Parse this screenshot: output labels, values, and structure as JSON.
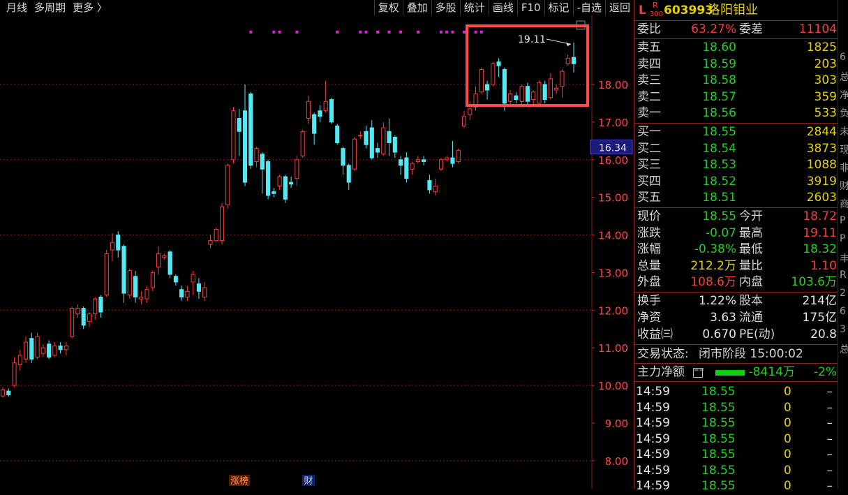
{
  "toolbar": {
    "left": [
      "月线",
      "多周期",
      "更多 〉"
    ],
    "right": [
      "复权",
      "叠加",
      "多股",
      "统计",
      "画线",
      "F10",
      "标记",
      "-自选",
      "返回"
    ]
  },
  "stock": {
    "market_letter": "L",
    "index_tag_top": "R",
    "index_tag_bottom": "300",
    "code": "603993",
    "name": "洛阳钼业"
  },
  "chart_data": {
    "type": "candlestick",
    "y_axis_labels": [
      "18.00",
      "17.00",
      "16.00",
      "15.00",
      "14.00",
      "13.00",
      "12.00",
      "11.00",
      "10.00",
      "9.00",
      "8.00"
    ],
    "ylim": [
      7.7,
      19.8
    ],
    "grid_lines": [
      18,
      16,
      14,
      12,
      10,
      8
    ],
    "current_price_tag": "16.34",
    "annotation_label": "19.11",
    "highlight_box": true,
    "bottom_tags": [
      "涨榜",
      "财"
    ],
    "candles": [
      {
        "o": 9.72,
        "c": 9.88,
        "h": 9.95,
        "l": 9.68
      },
      {
        "o": 9.85,
        "c": 9.75,
        "h": 9.92,
        "l": 9.7
      },
      {
        "o": 10.0,
        "c": 10.6,
        "h": 10.75,
        "l": 9.95
      },
      {
        "o": 10.55,
        "c": 10.8,
        "h": 10.95,
        "l": 10.4
      },
      {
        "o": 10.7,
        "c": 11.15,
        "h": 11.3,
        "l": 10.6
      },
      {
        "o": 11.25,
        "c": 10.7,
        "h": 11.4,
        "l": 10.6
      },
      {
        "o": 10.75,
        "c": 11.3,
        "h": 11.4,
        "l": 10.7
      },
      {
        "o": 10.85,
        "c": 11.0,
        "h": 11.1,
        "l": 10.75
      },
      {
        "o": 11.1,
        "c": 10.75,
        "h": 11.2,
        "l": 10.7
      },
      {
        "o": 10.8,
        "c": 11.05,
        "h": 11.15,
        "l": 10.75
      },
      {
        "o": 11.05,
        "c": 10.95,
        "h": 11.15,
        "l": 10.85
      },
      {
        "o": 10.95,
        "c": 11.05,
        "h": 11.15,
        "l": 10.8
      },
      {
        "o": 11.3,
        "c": 12.05,
        "h": 12.1,
        "l": 11.25
      },
      {
        "o": 11.9,
        "c": 12.05,
        "h": 12.15,
        "l": 11.8
      },
      {
        "o": 12.05,
        "c": 11.6,
        "h": 12.1,
        "l": 11.5
      },
      {
        "o": 11.7,
        "c": 11.9,
        "h": 11.95,
        "l": 11.55
      },
      {
        "o": 11.9,
        "c": 12.3,
        "h": 12.35,
        "l": 11.75
      },
      {
        "o": 12.35,
        "c": 11.95,
        "h": 12.4,
        "l": 11.8
      },
      {
        "o": 12.4,
        "c": 13.5,
        "h": 13.6,
        "l": 12.35
      },
      {
        "o": 13.6,
        "c": 13.8,
        "h": 14.05,
        "l": 13.3
      },
      {
        "o": 14.0,
        "c": 13.6,
        "h": 14.1,
        "l": 13.4
      },
      {
        "o": 13.7,
        "c": 12.45,
        "h": 13.75,
        "l": 12.2
      },
      {
        "o": 12.4,
        "c": 13.05,
        "h": 13.1,
        "l": 12.3
      },
      {
        "o": 12.9,
        "c": 12.35,
        "h": 13.05,
        "l": 12.2
      },
      {
        "o": 12.3,
        "c": 12.35,
        "h": 12.5,
        "l": 12.15
      },
      {
        "o": 12.3,
        "c": 12.55,
        "h": 12.65,
        "l": 12.2
      },
      {
        "o": 12.6,
        "c": 13.0,
        "h": 13.05,
        "l": 12.5
      },
      {
        "o": 13.15,
        "c": 13.5,
        "h": 13.7,
        "l": 12.95
      },
      {
        "o": 13.4,
        "c": 13.45,
        "h": 13.5,
        "l": 13.35
      },
      {
        "o": 13.55,
        "c": 12.95,
        "h": 13.6,
        "l": 12.85
      },
      {
        "o": 12.9,
        "c": 12.75,
        "h": 12.95,
        "l": 12.65
      },
      {
        "o": 12.55,
        "c": 12.35,
        "h": 12.65,
        "l": 12.25
      },
      {
        "o": 12.35,
        "c": 12.5,
        "h": 12.65,
        "l": 12.25
      },
      {
        "o": 12.75,
        "c": 12.95,
        "h": 13.05,
        "l": 12.4
      },
      {
        "o": 12.7,
        "c": 12.5,
        "h": 12.85,
        "l": 12.3
      },
      {
        "o": 12.35,
        "c": 12.6,
        "h": 12.75,
        "l": 12.25
      },
      {
        "o": 13.75,
        "c": 13.85,
        "h": 14.0,
        "l": 13.65
      },
      {
        "o": 13.85,
        "c": 14.15,
        "h": 14.2,
        "l": 13.8
      },
      {
        "o": 13.85,
        "c": 14.75,
        "h": 14.85,
        "l": 13.75
      },
      {
        "o": 14.8,
        "c": 15.85,
        "h": 15.9,
        "l": 14.7
      },
      {
        "o": 16.0,
        "c": 17.3,
        "h": 17.4,
        "l": 15.9
      },
      {
        "o": 17.1,
        "c": 16.75,
        "h": 17.35,
        "l": 16.1
      },
      {
        "o": 17.3,
        "c": 15.4,
        "h": 18.0,
        "l": 15.3
      },
      {
        "o": 17.75,
        "c": 15.85,
        "h": 17.8,
        "l": 15.75
      },
      {
        "o": 15.95,
        "c": 16.3,
        "h": 16.35,
        "l": 15.8
      },
      {
        "o": 16.15,
        "c": 15.75,
        "h": 16.2,
        "l": 15.1
      },
      {
        "o": 15.95,
        "c": 15.05,
        "h": 16.0,
        "l": 14.95
      },
      {
        "o": 15.15,
        "c": 15.1,
        "h": 15.25,
        "l": 15.0
      },
      {
        "o": 15.3,
        "c": 15.55,
        "h": 15.6,
        "l": 15.2
      },
      {
        "o": 15.55,
        "c": 14.95,
        "h": 15.6,
        "l": 14.85
      },
      {
        "o": 15.4,
        "c": 15.35,
        "h": 15.55,
        "l": 15.25
      },
      {
        "o": 15.5,
        "c": 16.0,
        "h": 16.1,
        "l": 15.3
      },
      {
        "o": 16.1,
        "c": 16.75,
        "h": 16.8,
        "l": 16.05
      },
      {
        "o": 17.1,
        "c": 17.55,
        "h": 17.7,
        "l": 16.95
      },
      {
        "o": 17.2,
        "c": 16.7,
        "h": 17.25,
        "l": 16.4
      },
      {
        "o": 17.3,
        "c": 17.15,
        "h": 17.45,
        "l": 17.0
      },
      {
        "o": 17.3,
        "c": 17.55,
        "h": 18.1,
        "l": 17.25
      },
      {
        "o": 17.6,
        "c": 17.0,
        "h": 17.65,
        "l": 16.95
      },
      {
        "o": 16.9,
        "c": 16.45,
        "h": 16.95,
        "l": 16.4
      },
      {
        "o": 16.3,
        "c": 15.85,
        "h": 16.35,
        "l": 15.6
      },
      {
        "o": 15.85,
        "c": 15.4,
        "h": 15.9,
        "l": 15.2
      },
      {
        "o": 15.75,
        "c": 16.55,
        "h": 16.6,
        "l": 15.7
      },
      {
        "o": 16.65,
        "c": 16.65,
        "h": 16.75,
        "l": 16.55
      },
      {
        "o": 16.75,
        "c": 16.4,
        "h": 16.9,
        "l": 16.3
      },
      {
        "o": 16.85,
        "c": 16.05,
        "h": 17.05,
        "l": 16.0
      },
      {
        "o": 16.3,
        "c": 16.2,
        "h": 16.45,
        "l": 16.05
      },
      {
        "o": 16.15,
        "c": 16.85,
        "h": 17.0,
        "l": 16.1
      },
      {
        "o": 16.75,
        "c": 16.45,
        "h": 17.1,
        "l": 16.1
      },
      {
        "o": 16.6,
        "c": 16.2,
        "h": 16.65,
        "l": 16.05
      },
      {
        "o": 16.0,
        "c": 15.85,
        "h": 16.1,
        "l": 15.6
      },
      {
        "o": 16.05,
        "c": 15.5,
        "h": 16.2,
        "l": 15.4
      },
      {
        "o": 15.75,
        "c": 15.9,
        "h": 15.95,
        "l": 15.6
      },
      {
        "o": 15.95,
        "c": 16.0,
        "h": 16.1,
        "l": 15.9
      },
      {
        "o": 16.0,
        "c": 15.95,
        "h": 16.1,
        "l": 15.85
      },
      {
        "o": 15.45,
        "c": 15.2,
        "h": 15.6,
        "l": 15.1
      },
      {
        "o": 15.15,
        "c": 15.3,
        "h": 15.5,
        "l": 15.05
      },
      {
        "o": 15.75,
        "c": 16.0,
        "h": 16.05,
        "l": 15.7
      },
      {
        "o": 16.0,
        "c": 16.05,
        "h": 16.1,
        "l": 15.95
      },
      {
        "o": 16.05,
        "c": 15.9,
        "h": 16.5,
        "l": 15.8
      },
      {
        "o": 15.95,
        "c": 16.25,
        "h": 16.3,
        "l": 15.9
      },
      {
        "o": 16.9,
        "c": 17.15,
        "h": 17.3,
        "l": 16.85
      },
      {
        "o": 17.2,
        "c": 17.35,
        "h": 17.55,
        "l": 17.05
      },
      {
        "o": 17.4,
        "c": 17.75,
        "h": 17.95,
        "l": 17.3
      },
      {
        "o": 17.8,
        "c": 18.4,
        "h": 18.45,
        "l": 17.75
      },
      {
        "o": 18.0,
        "c": 17.85,
        "h": 18.1,
        "l": 17.6
      },
      {
        "o": 18.0,
        "c": 18.55,
        "h": 18.6,
        "l": 17.95
      },
      {
        "o": 18.6,
        "c": 18.5,
        "h": 18.7,
        "l": 18.2
      },
      {
        "o": 18.4,
        "c": 17.5,
        "h": 18.45,
        "l": 17.3
      },
      {
        "o": 17.55,
        "c": 17.75,
        "h": 17.85,
        "l": 17.45
      },
      {
        "o": 17.7,
        "c": 17.6,
        "h": 17.8,
        "l": 17.5
      },
      {
        "o": 17.55,
        "c": 17.95,
        "h": 18.0,
        "l": 17.45
      },
      {
        "o": 17.95,
        "c": 17.55,
        "h": 18.05,
        "l": 17.45
      },
      {
        "o": 17.6,
        "c": 17.8,
        "h": 17.85,
        "l": 17.4
      },
      {
        "o": 17.5,
        "c": 18.05,
        "h": 18.1,
        "l": 17.45
      },
      {
        "o": 18.0,
        "c": 17.6,
        "h": 18.1,
        "l": 17.5
      },
      {
        "o": 17.65,
        "c": 18.15,
        "h": 18.3,
        "l": 17.6
      },
      {
        "o": 17.85,
        "c": 17.9,
        "h": 18.0,
        "l": 17.75
      },
      {
        "o": 17.95,
        "c": 18.35,
        "h": 18.4,
        "l": 17.65
      },
      {
        "o": 18.55,
        "c": 18.7,
        "h": 18.8,
        "l": 18.5
      },
      {
        "o": 18.72,
        "c": 18.55,
        "h": 19.11,
        "l": 18.32
      }
    ],
    "marker_dots": [
      0,
      0,
      0,
      0,
      0,
      0,
      0,
      0,
      0,
      0,
      0,
      0,
      0,
      0,
      0,
      0,
      0,
      0,
      0,
      0,
      0,
      0,
      0,
      0,
      0,
      0,
      0,
      0,
      0,
      0,
      0,
      0,
      0,
      0,
      0,
      0,
      0,
      0,
      0,
      0,
      0,
      0,
      0,
      1,
      0,
      0,
      0,
      1,
      1,
      0,
      0,
      1,
      0,
      0,
      0,
      0,
      0,
      0,
      1,
      0,
      0,
      0,
      1,
      1,
      0,
      1,
      0,
      1,
      0,
      1,
      0,
      0,
      1,
      0,
      0,
      0,
      1,
      1,
      1,
      0,
      1,
      0,
      1,
      1,
      0,
      0,
      0,
      0,
      0,
      0,
      0,
      0,
      0,
      0,
      0,
      0,
      0,
      0,
      0,
      0
    ]
  },
  "quote": {
    "weibi": {
      "label": "委比",
      "value": "63.27%",
      "label2": "委差",
      "value2": "11104"
    },
    "sells": [
      {
        "label": "卖五",
        "price": "18.60",
        "vol": "1825"
      },
      {
        "label": "卖四",
        "price": "18.59",
        "vol": "203"
      },
      {
        "label": "卖三",
        "price": "18.58",
        "vol": "303"
      },
      {
        "label": "卖二",
        "price": "18.57",
        "vol": "359"
      },
      {
        "label": "卖一",
        "price": "18.56",
        "vol": "533"
      }
    ],
    "buys": [
      {
        "label": "买一",
        "price": "18.55",
        "vol": "2844"
      },
      {
        "label": "买二",
        "price": "18.54",
        "vol": "3873"
      },
      {
        "label": "买三",
        "price": "18.53",
        "vol": "1088"
      },
      {
        "label": "买四",
        "price": "18.52",
        "vol": "3919"
      },
      {
        "label": "买五",
        "price": "18.51",
        "vol": "2603"
      }
    ],
    "stats": [
      {
        "l1": "现价",
        "v1": "18.55",
        "c1": "g",
        "l2": "今开",
        "v2": "18.72",
        "c2": "r"
      },
      {
        "l1": "涨跌",
        "v1": "-0.07",
        "c1": "g",
        "l2": "最高",
        "v2": "19.11",
        "c2": "r"
      },
      {
        "l1": "涨幅",
        "v1": "-0.38%",
        "c1": "g",
        "l2": "最低",
        "v2": "18.32",
        "c2": "g"
      },
      {
        "l1": "总量",
        "v1": "212.2万",
        "c1": "y",
        "l2": "量比",
        "v2": "1.10",
        "c2": "r"
      },
      {
        "l1": "外盘",
        "v1": "108.6万",
        "c1": "r",
        "l2": "内盘",
        "v2": "103.6万",
        "c2": "g"
      }
    ],
    "finance": [
      {
        "l1": "换手",
        "v1": "1.22%",
        "l2": "股本",
        "v2": "214亿"
      },
      {
        "l1": "净资",
        "v1": "3.63",
        "l2": "流通",
        "v2": "175亿"
      },
      {
        "l1": "收益㈢",
        "v1": "0.670",
        "l2": "PE(动)",
        "v2": "20.8"
      }
    ],
    "status": {
      "label": "交易状态:",
      "value": "闭市阶段 15:00:02"
    },
    "flow": {
      "label": "主力净额",
      "value": "-8414万",
      "pct": "-2%"
    },
    "ticks": [
      {
        "time": "14:59",
        "price": "18.55",
        "vol": "0",
        "dir": "–"
      },
      {
        "time": "14:59",
        "price": "18.55",
        "vol": "0",
        "dir": "–"
      },
      {
        "time": "14:59",
        "price": "18.55",
        "vol": "0",
        "dir": "–"
      },
      {
        "time": "14:59",
        "price": "18.55",
        "vol": "0",
        "dir": "–"
      },
      {
        "time": "14:59",
        "price": "18.55",
        "vol": "0",
        "dir": "–"
      },
      {
        "time": "14:59",
        "price": "18.55",
        "vol": "0",
        "dir": "–"
      },
      {
        "time": "14:59",
        "price": "18.55",
        "vol": "0",
        "dir": "–"
      }
    ]
  },
  "edge_glyphs": [
    "6",
    "总",
    "净",
    "负",
    "未",
    "现",
    "非",
    "财",
    "商",
    "P",
    "P",
    "丰",
    "R",
    "2",
    "6",
    "3",
    "总"
  ],
  "colors": {
    "up": "#ff3a3a",
    "down": "#54e8f2",
    "grid": "#8a1c1c",
    "marker": "#e020e0",
    "highlight": "#ff4a4a"
  }
}
